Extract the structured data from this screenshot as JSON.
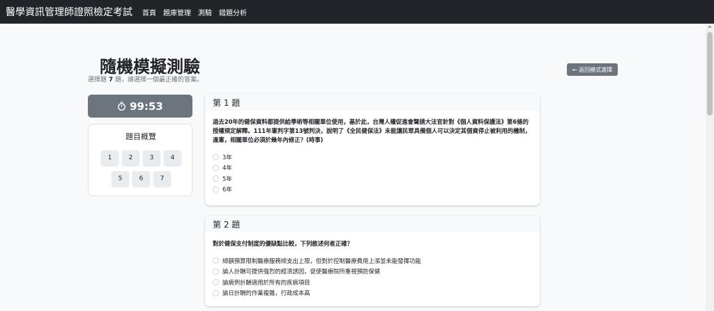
{
  "navbar": {
    "brand": "醫學資訊管理師證照檢定考試",
    "links": [
      "首頁",
      "題庫管理",
      "測驗",
      "錯題分析"
    ]
  },
  "page": {
    "title": "隨機模擬測驗",
    "subtitle_prefix": "選擇題 ",
    "question_count": "7",
    "subtitle_suffix": " 題，請選擇一個最正確的答案。",
    "back_button": "← 返回模式選擇"
  },
  "timer": {
    "value": "99:53",
    "icon": "stopwatch-icon"
  },
  "overview": {
    "title": "題目概覽",
    "buttons": [
      "1",
      "2",
      "3",
      "4",
      "5",
      "6",
      "7"
    ]
  },
  "questions": [
    {
      "header": "第 1 題",
      "text": "過去20年的健保資料都提供給學術等相關單位使用，基於此，台灣人權促進會聲請大法官針對《個人資料保護法》第6條的授權規定解釋。111年憲判字第13號判決，說明了《全民健保法》未能讓民眾具備個人可以決定其個資停止被利用的機制，違憲，相關單位必須於幾年內修正？(時事)",
      "options": [
        "3年",
        "4年",
        "5年",
        "6年"
      ]
    },
    {
      "header": "第 2 題",
      "text": "對於健保支付制度的優缺點比較，下列敘述何者正確？",
      "options": [
        "總額預算限制醫療服務總支出上限，但對於控制醫療費用上漲並未能發揮功能",
        "論人計酬可提供強烈的經濟誘因，促使醫療院所重視預防保健",
        "論病例計酬適用於所有的疾病項目",
        "論日計酬的作業複雜，行政成本高"
      ]
    }
  ],
  "colors": {
    "navbar": "#212529",
    "secondary": "#6c757d",
    "light": "#f8f9fa"
  }
}
